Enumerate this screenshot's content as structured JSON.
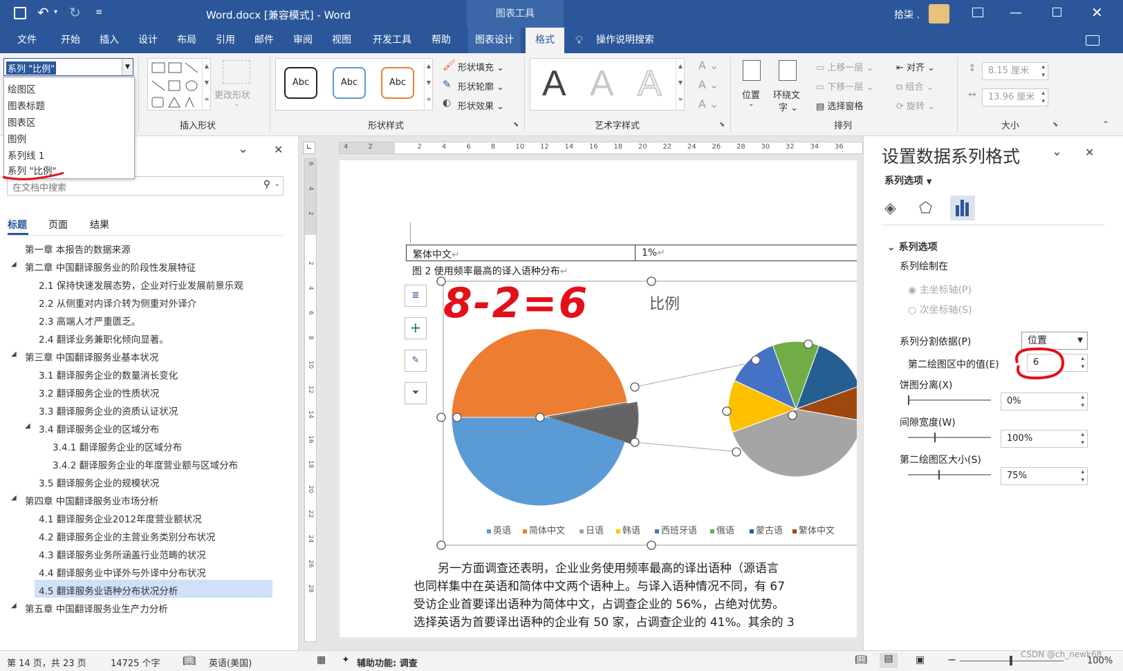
{
  "titlebar": {
    "filename": "Word.docx [兼容模式]",
    "sep": "-",
    "app": "Word",
    "context_tool": "图表工具",
    "user": "拾柒 ."
  },
  "tabs": [
    "文件",
    "开始",
    "插入",
    "设计",
    "布局",
    "引用",
    "邮件",
    "审阅",
    "视图",
    "开发工具",
    "帮助",
    "图表设计",
    "格式"
  ],
  "active_tab": "格式",
  "tell_me": "操作说明搜索",
  "ribbon": {
    "element_select": "系列 \"比例\"",
    "dropdown_items": [
      "绘图区",
      "图表标题",
      "图表区",
      "图例",
      "系列线 1",
      "系列 \"比例\""
    ],
    "change_shape": "更改形状",
    "insert_shapes_label": "插入形状",
    "abc": "Abc",
    "shape_fill": "形状填充",
    "shape_outline": "形状轮廓",
    "shape_effect": "形状效果",
    "shape_styles_label": "形状样式",
    "wordart_letter": "A",
    "wordart_label": "艺术字样式",
    "position": "位置",
    "wrap_text_1": "环绕文",
    "wrap_text_2": "字",
    "bring_forward": "上移一层",
    "send_backward": "下移一层",
    "selection_pane": "选择窗格",
    "align": "对齐",
    "group": "组合",
    "rotate": "旋转",
    "arrange_label": "排列",
    "height": "8.15 厘米",
    "width": "13.96 厘米",
    "size_label": "大小"
  },
  "nav": {
    "search_placeholder": "在文档中搜索",
    "tabs": [
      "标题",
      "页面",
      "结果"
    ],
    "items": [
      {
        "text": "第一章 本报告的数据来源",
        "level": 1,
        "arrow": false
      },
      {
        "text": "第二章 中国翻译服务业的阶段性发展特征",
        "level": 1,
        "arrow": true
      },
      {
        "text": "2.1 保持快速发展态势，企业对行业发展前景乐观",
        "level": 2,
        "arrow": false
      },
      {
        "text": "2.2 从侧重对内译介转为侧重对外译介",
        "level": 2,
        "arrow": false
      },
      {
        "text": "2.3 高端人才严重匮乏。",
        "level": 2,
        "arrow": false
      },
      {
        "text": "2.4 翻译业务兼职化倾向显著。",
        "level": 2,
        "arrow": false
      },
      {
        "text": "第三章 中国翻译服务业基本状况",
        "level": 1,
        "arrow": true
      },
      {
        "text": "3.1 翻译服务企业的数量消长变化",
        "level": 2,
        "arrow": false
      },
      {
        "text": "3.2 翻译服务企业的性质状况",
        "level": 2,
        "arrow": false
      },
      {
        "text": "3.3 翻译服务企业的资质认证状况",
        "level": 2,
        "arrow": false
      },
      {
        "text": "3.4 翻译服务企业的区域分布",
        "level": 2,
        "arrow": true
      },
      {
        "text": "3.4.1 翻译服务企业的区域分布",
        "level": 3,
        "arrow": false
      },
      {
        "text": "3.4.2 翻译服务企业的年度营业额与区域分布",
        "level": 3,
        "arrow": false
      },
      {
        "text": "3.5 翻译服务企业的规模状况",
        "level": 2,
        "arrow": false
      },
      {
        "text": "第四章 中国翻译服务业市场分析",
        "level": 1,
        "arrow": true
      },
      {
        "text": "4.1 翻译服务企业2012年度营业额状况",
        "level": 2,
        "arrow": false
      },
      {
        "text": "4.2 翻译服务企业的主营业务类别分布状况",
        "level": 2,
        "arrow": false
      },
      {
        "text": "4.3 翻译服务业务所涵盖行业范畴的状况",
        "level": 2,
        "arrow": false
      },
      {
        "text": "4.4 翻译服务业中译外与外译中分布状况",
        "level": 2,
        "arrow": false
      },
      {
        "text": "4.5 翻译服务业语种分布状况分析",
        "level": 2,
        "arrow": false
      },
      {
        "text": "第五章 中国翻译服务业生产力分析",
        "level": 1,
        "arrow": true
      }
    ]
  },
  "ruler": {
    "h": [
      "4",
      "2",
      "",
      "2",
      "4",
      "6",
      "8",
      "10",
      "12",
      "14",
      "16",
      "18",
      "20",
      "22",
      "24",
      "26",
      "28",
      "30",
      "32",
      "34",
      "36"
    ],
    "v": [
      "6",
      "4",
      "2",
      "",
      "2",
      "4",
      "6",
      "8",
      "10",
      "12",
      "14",
      "16",
      "18",
      "20",
      "22",
      "24",
      "26",
      "28"
    ]
  },
  "doc": {
    "table_cell_1": "繁体中文",
    "table_cell_2": "1%",
    "caption": "图 2 使用频率最高的译入语种分布",
    "handwriting": "8-2=6",
    "chart_title": "比例",
    "para": [
      "另一方面调查还表明，企业业务使用频率最高的译出语种（源语言",
      "也同样集中在英语和简体中文两个语种上。与译入语种情况不同，有 67",
      "受访企业首要译出语种为简体中文，占调查企业的 56%，占绝对优势。",
      "选择英语为首要译出语种的企业有 50 家，占调查企业的 41%。其余的 3"
    ]
  },
  "chart_data": {
    "type": "pie",
    "subtype": "pie-of-pie",
    "title": "比例",
    "categories": [
      "英语",
      "简体中文",
      "日语",
      "韩语",
      "西班牙语",
      "俄语",
      "蒙古语",
      "繁体中文"
    ],
    "colors": [
      "#5b9bd5",
      "#ed7d31",
      "#a5a5a5",
      "#ffc000",
      "#4472c4",
      "#70ad47",
      "#255e91",
      "#9e480e"
    ],
    "second_plot_values": 6,
    "legend_position": "bottom"
  },
  "rightpane": {
    "title": "设置数据系列格式",
    "series_options_dropdown": "系列选项",
    "section": "系列选项",
    "plot_on": "系列绘制在",
    "primary_axis": "主坐标轴(P)",
    "secondary_axis": "次坐标轴(S)",
    "split_by_label": "系列分割依据(P)",
    "split_by_value": "位置",
    "values_in_second_label": "第二绘图区中的值(E)",
    "values_in_second_value": "6",
    "explosion_label": "饼图分离(X)",
    "explosion_value": "0%",
    "gap_label": "间隙宽度(W)",
    "gap_value": "100%",
    "second_size_label": "第二绘图区大小(S)",
    "second_size_value": "75%"
  },
  "status": {
    "page": "第 14 页，共 23 页",
    "words": "14725 个字",
    "language": "英语(美国)",
    "accessibility": "辅助功能: 调查",
    "zoom": "100%",
    "watermark": "CSDN @ch_newk68"
  }
}
